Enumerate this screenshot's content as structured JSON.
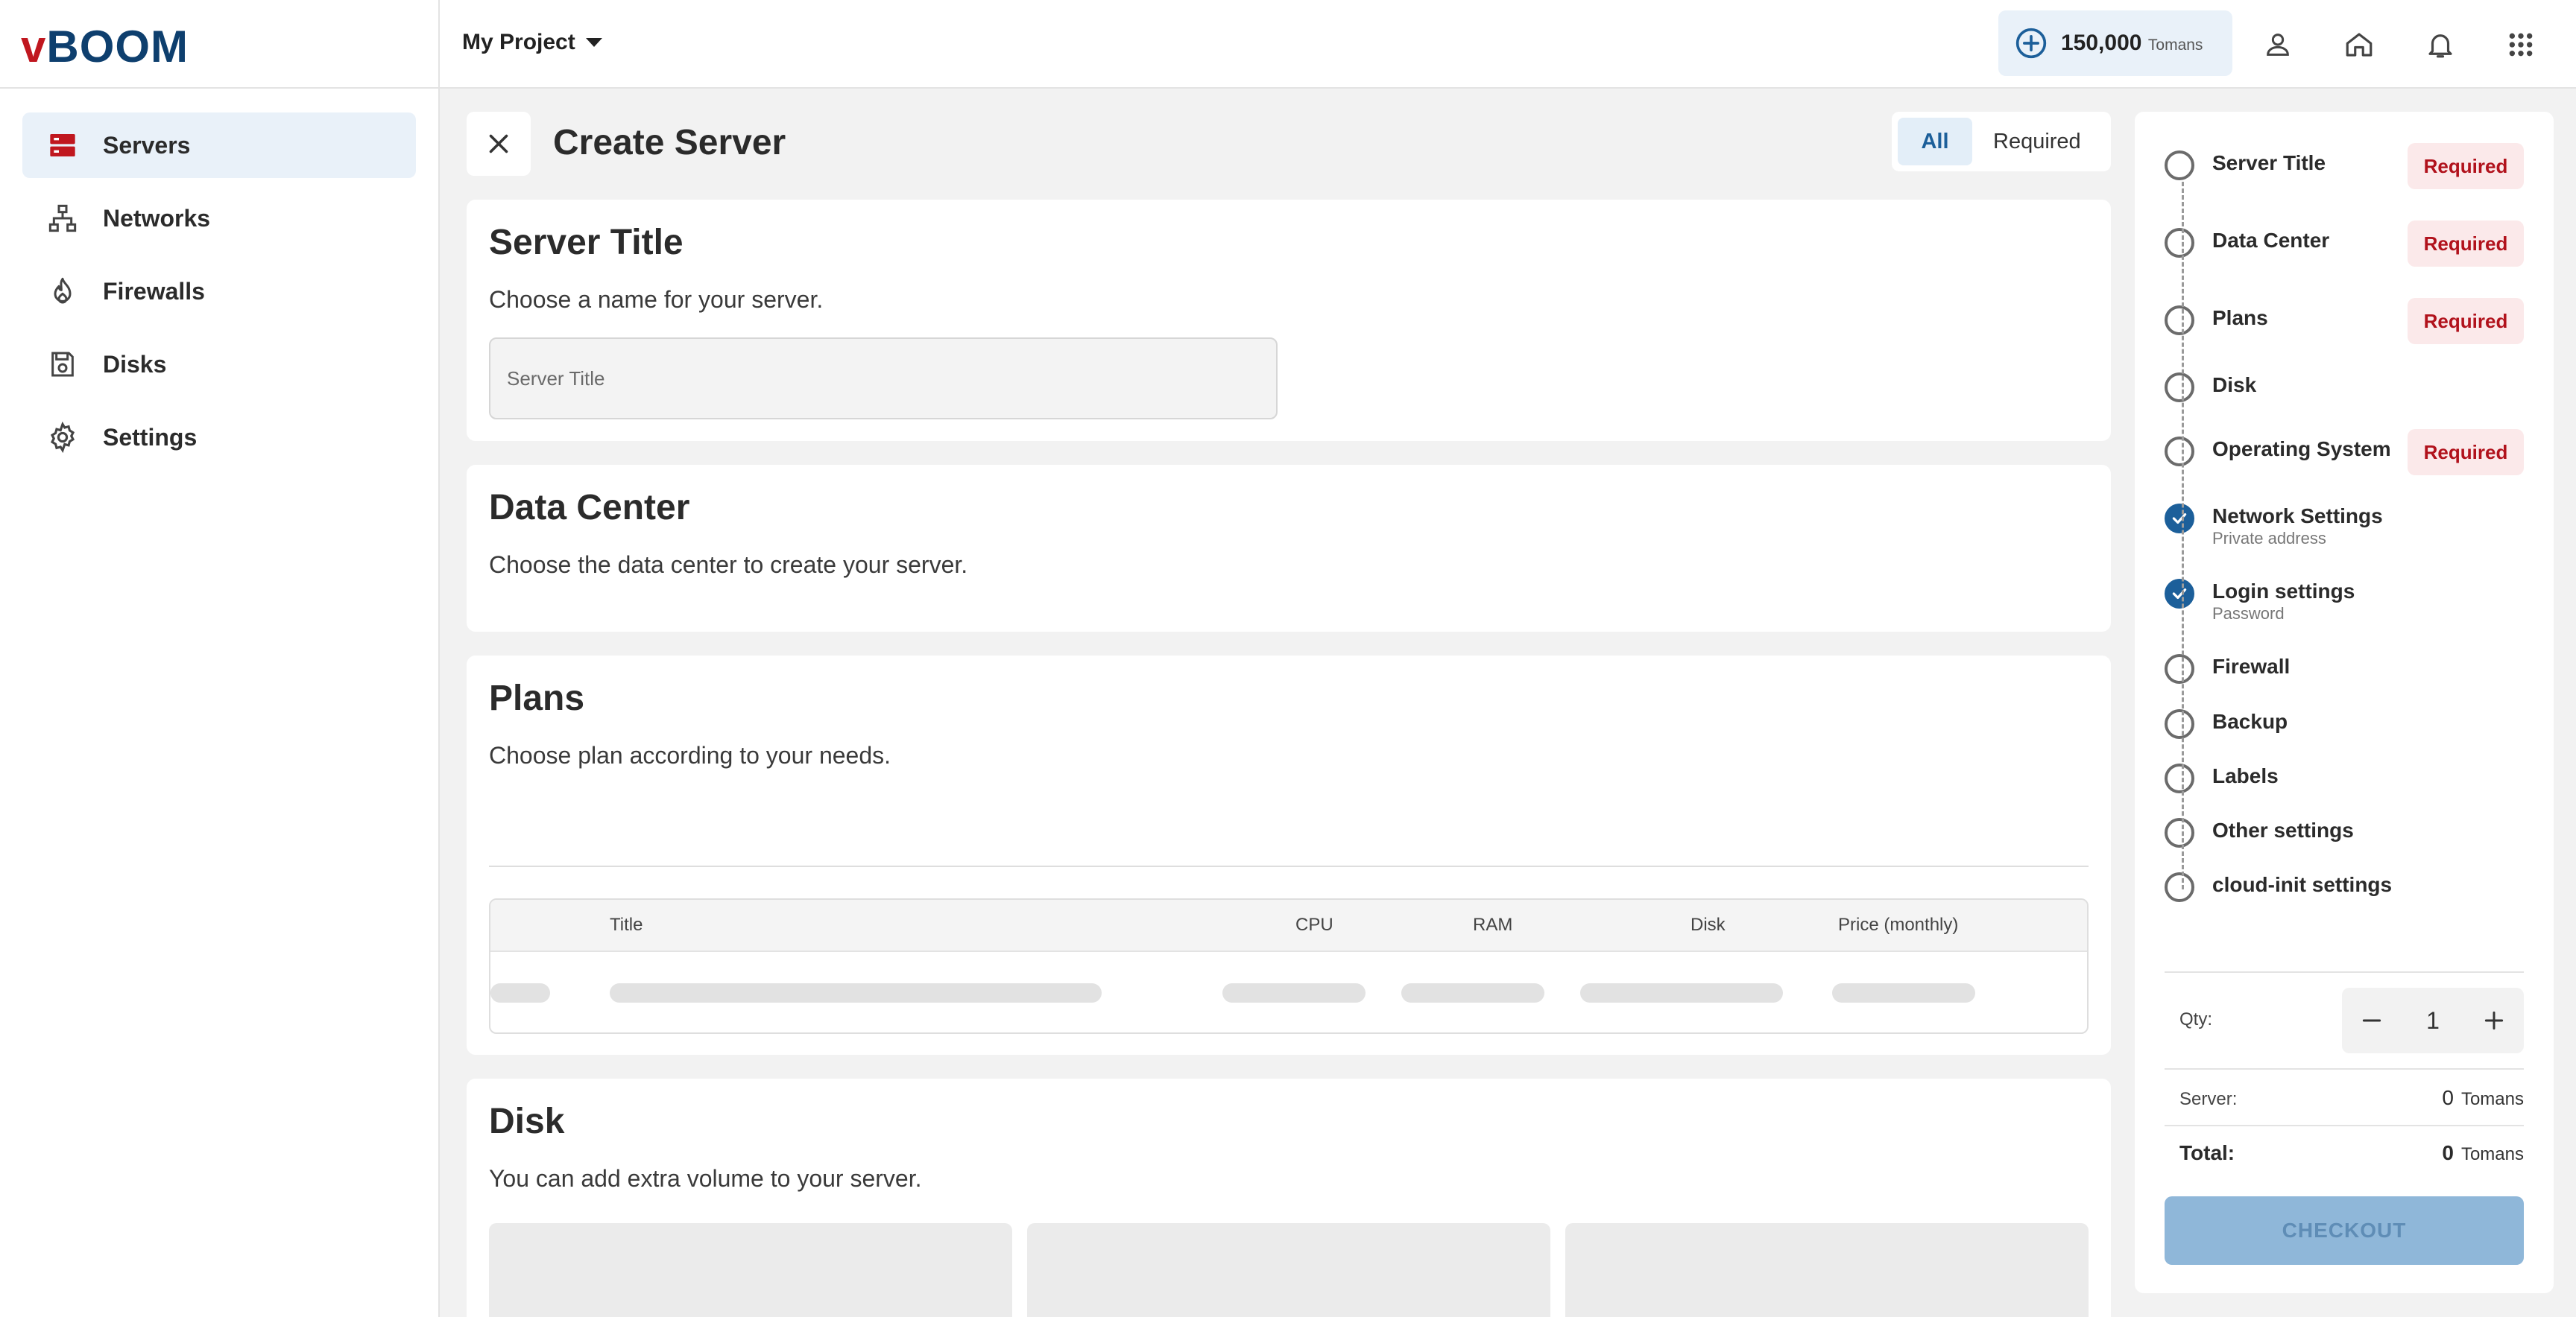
{
  "header": {
    "logo_v": "v",
    "logo_rest": "BOOM",
    "project": "My Project",
    "balance_amount": "150,000",
    "balance_currency": "Tomans",
    "icons": [
      "add-circle-icon",
      "user-icon",
      "home-icon",
      "bell-icon",
      "apps-grid-icon"
    ]
  },
  "sidebar": {
    "items": [
      {
        "label": "Servers",
        "icon": "server-icon",
        "active": true
      },
      {
        "label": "Networks",
        "icon": "network-icon"
      },
      {
        "label": "Firewalls",
        "icon": "fire-icon"
      },
      {
        "label": "Disks",
        "icon": "disk-icon"
      },
      {
        "label": "Settings",
        "icon": "gear-icon"
      }
    ]
  },
  "page": {
    "title": "Create Server",
    "filter": {
      "all": "All",
      "required": "Required",
      "selected": "All"
    }
  },
  "sections": {
    "server_title": {
      "heading": "Server Title",
      "description": "Choose a name for your server.",
      "input_placeholder": "Server Title",
      "input_value": ""
    },
    "data_center": {
      "heading": "Data Center",
      "description": "Choose the data center to create your server."
    },
    "plans": {
      "heading": "Plans",
      "description": "Choose plan according to your needs.",
      "columns": [
        "Title",
        "CPU",
        "RAM",
        "Disk",
        "Price (monthly)"
      ]
    },
    "disk": {
      "heading": "Disk",
      "description": "You can add extra volume to your server."
    }
  },
  "steps": [
    {
      "label": "Server Title",
      "badge": "Required",
      "done": false
    },
    {
      "label": "Data Center",
      "badge": "Required",
      "done": false
    },
    {
      "label": "Plans",
      "badge": "Required",
      "done": false
    },
    {
      "label": "Disk",
      "done": false
    },
    {
      "label": "Operating System",
      "badge": "Required",
      "done": false
    },
    {
      "label": "Network Settings",
      "sub": "Private address",
      "done": true
    },
    {
      "label": "Login settings",
      "sub": "Password",
      "done": true
    },
    {
      "label": "Firewall",
      "done": false
    },
    {
      "label": "Backup",
      "done": false
    },
    {
      "label": "Labels",
      "done": false
    },
    {
      "label": "Other settings",
      "done": false
    },
    {
      "label": "cloud-init settings",
      "done": false
    }
  ],
  "order": {
    "qty_label": "Qty:",
    "qty": "1",
    "server_label": "Server:",
    "server_price": "0",
    "total_label": "Total:",
    "total_price": "0",
    "currency": "Tomans",
    "checkout": "CHECKOUT"
  },
  "colors": {
    "brand_red": "#c0171f",
    "brand_blue": "#0e3f6e",
    "accent": "#1c5f9a",
    "required": "#b1121c"
  }
}
